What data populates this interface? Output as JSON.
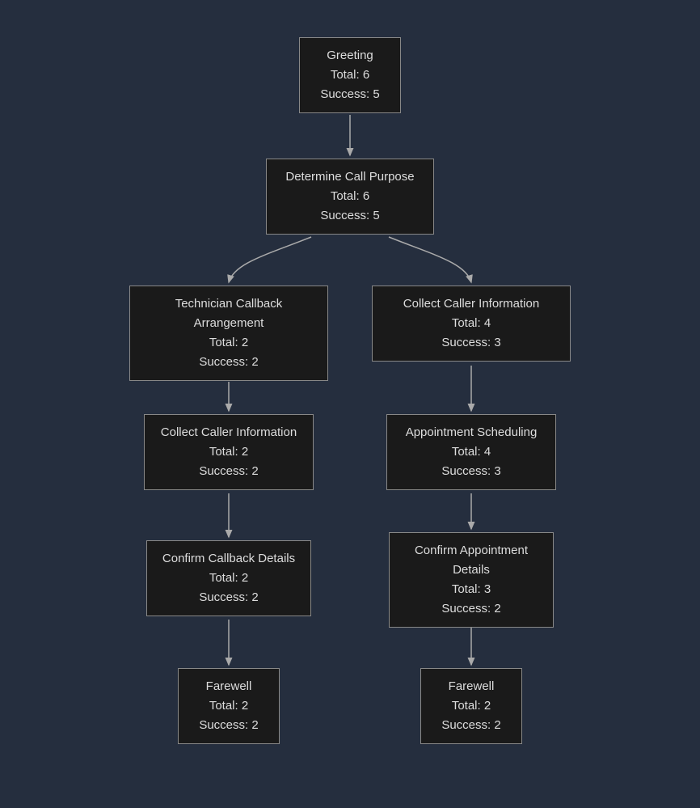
{
  "labels": {
    "total_prefix": "Total: ",
    "success_prefix": "Success: "
  },
  "nodes": {
    "greeting": {
      "title": "Greeting",
      "total": 6,
      "success": 5
    },
    "determine": {
      "title": "Determine Call Purpose",
      "total": 6,
      "success": 5
    },
    "tech_callback": {
      "title": "Technician Callback Arrangement",
      "total": 2,
      "success": 2
    },
    "collect_right": {
      "title": "Collect Caller Information",
      "total": 4,
      "success": 3
    },
    "collect_left": {
      "title": "Collect Caller Information",
      "total": 2,
      "success": 2
    },
    "appt_sched": {
      "title": "Appointment Scheduling",
      "total": 4,
      "success": 3
    },
    "confirm_callback": {
      "title": "Confirm Callback Details",
      "total": 2,
      "success": 2
    },
    "confirm_appt": {
      "title": "Confirm Appointment Details",
      "total": 3,
      "success": 2
    },
    "farewell_left": {
      "title": "Farewell",
      "total": 2,
      "success": 2
    },
    "farewell_right": {
      "title": "Farewell",
      "total": 2,
      "success": 2
    }
  }
}
